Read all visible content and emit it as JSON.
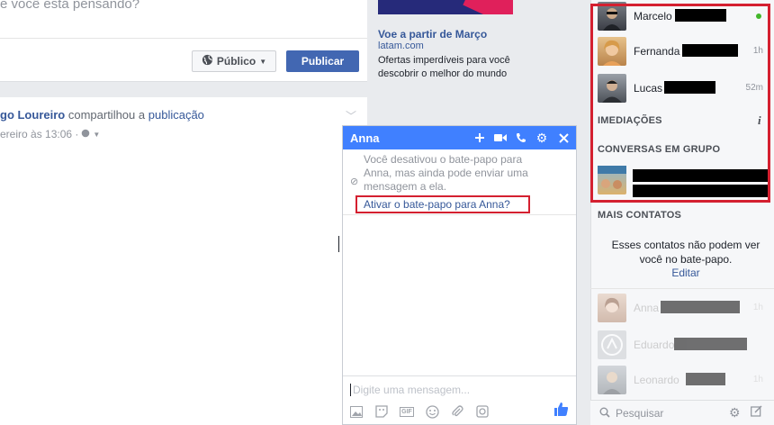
{
  "composer": {
    "placeholder": "e você está pensando?",
    "audience_label": "Público",
    "publish_label": "Publicar"
  },
  "post": {
    "author": "go Loureiro",
    "action": "compartilhou a",
    "target": "publicação",
    "meta": "ereiro às 13:06 ·"
  },
  "ad": {
    "title": "Voe a partir de Março",
    "domain": "latam.com",
    "description": "Ofertas imperdíveis para você descobrir o melhor do mundo"
  },
  "chat": {
    "title": "Anna",
    "notice": "Você desativou o bate-papo para Anna, mas ainda pode enviar uma mensagem a ela.",
    "enable_link": "Ativar o bate-papo para Anna?",
    "input_placeholder": "Digite uma mensagem..."
  },
  "sidebar": {
    "contacts": [
      {
        "name": "Marcelo",
        "time": "",
        "online": true
      },
      {
        "name": "Fernanda",
        "time": "1h",
        "online": false
      },
      {
        "name": "Lucas",
        "time": "52m",
        "online": false
      }
    ],
    "nearby_title": "IMEDIAÇÕES",
    "groups_title": "CONVERSAS EM GRUPO",
    "more_title": "MAIS CONTATOS",
    "more_note": "Esses contatos não podem ver você no bate-papo.",
    "edit_label": "Editar",
    "more_contacts": [
      {
        "name": "Anna",
        "time": "1h"
      },
      {
        "name": "Eduardo",
        "time": ""
      },
      {
        "name": "Leonardo",
        "time": "1h"
      }
    ],
    "search_placeholder": "Pesquisar"
  },
  "colors": {
    "brand": "#4267b2",
    "chat_header": "#4080ff",
    "highlight": "#d42030",
    "online": "#42b72a"
  }
}
